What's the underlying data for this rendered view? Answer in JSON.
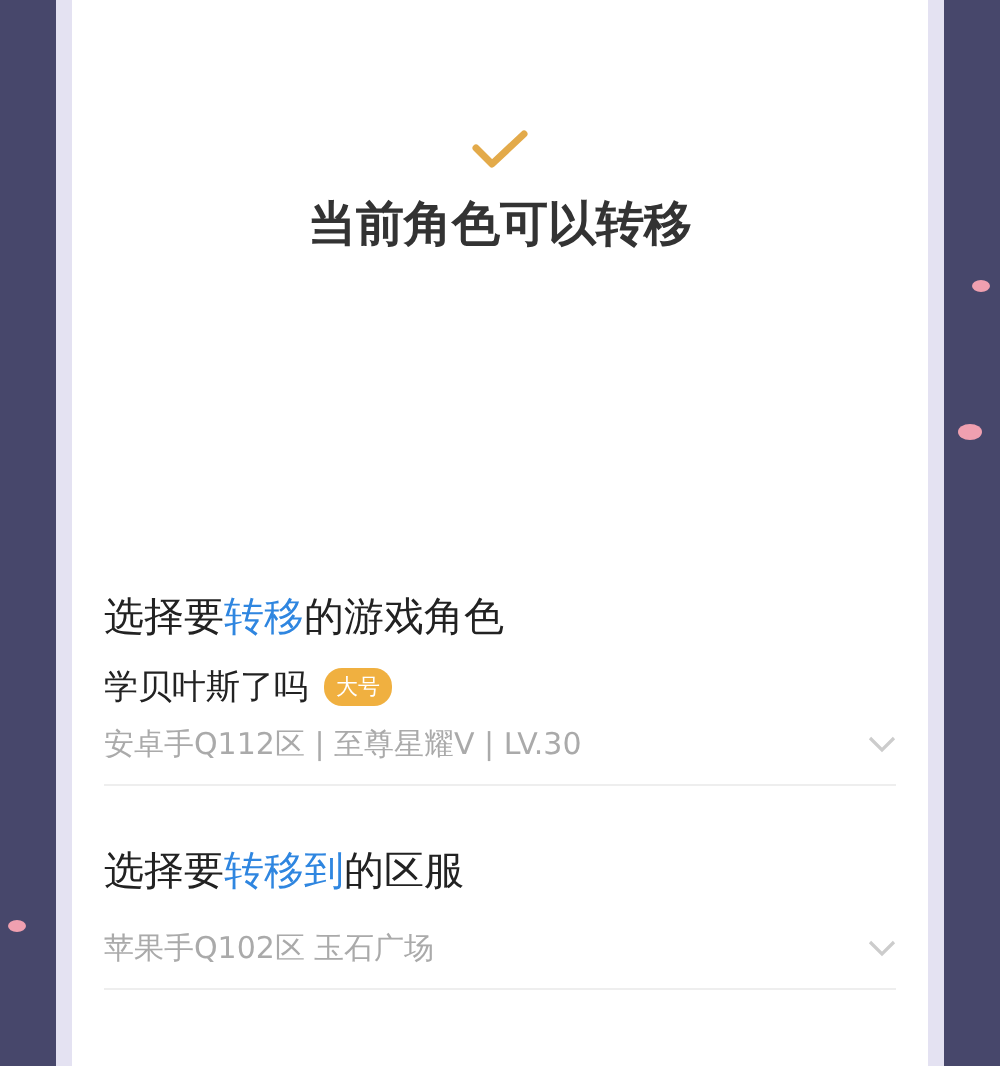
{
  "status": {
    "title": "当前角色可以转移"
  },
  "sections": [
    {
      "heading": "选择要**转移**的游戏角色",
      "name": "学贝叶斯了吗",
      "badge": "大号",
      "detail": "安卓手Q112区 | 至尊星耀V | LV.30"
    },
    {
      "heading": "选择要**转移到**的区服",
      "detail": "苹果手Q102区 玉石广场"
    }
  ]
}
